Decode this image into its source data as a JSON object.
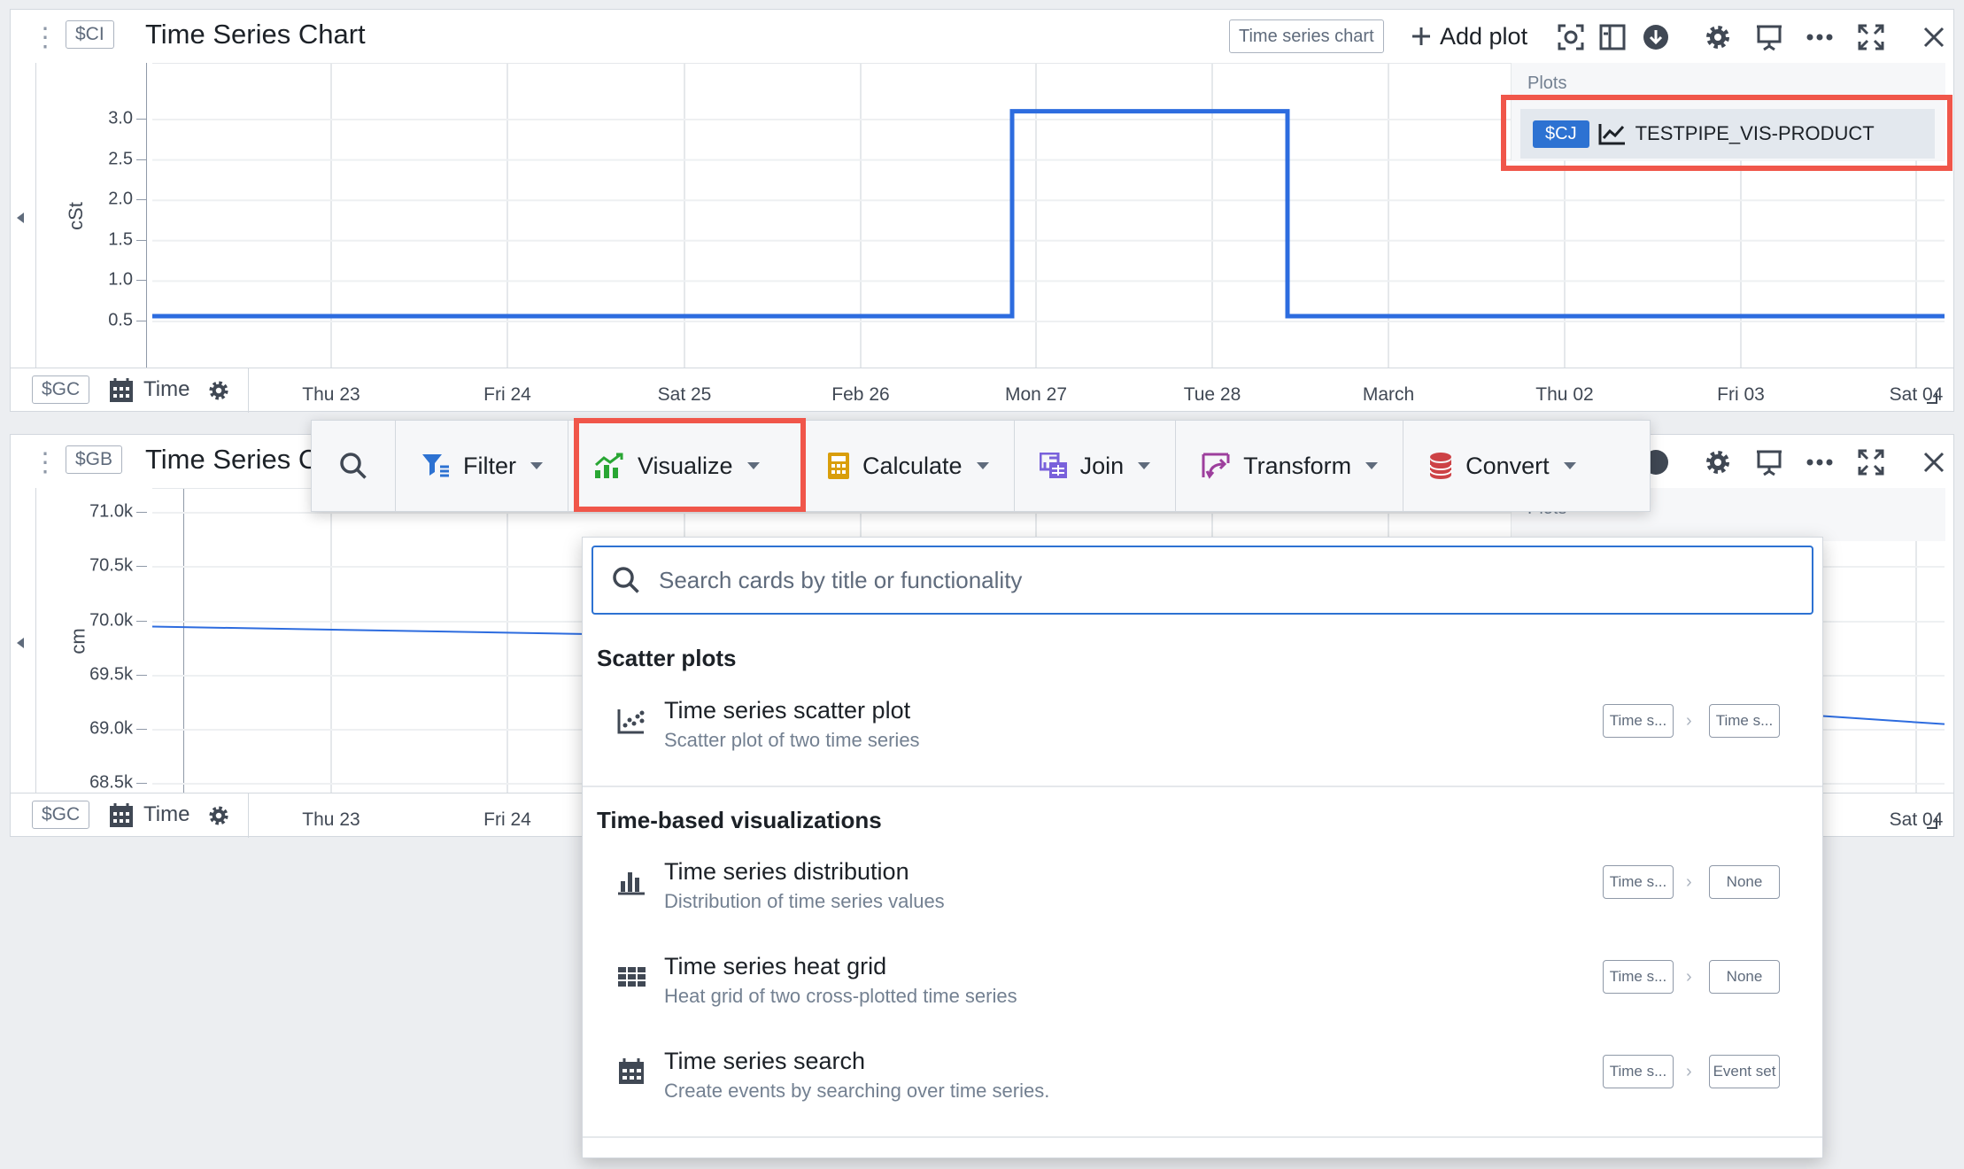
{
  "card1": {
    "grip": "⋮⋮",
    "id_tag": "$CI",
    "title": "Time Series Chart",
    "type_tag": "Time series chart",
    "add_plot": "Add plot",
    "y_label": "cSt",
    "y_ticks": [
      "3.0",
      "2.5",
      "2.0",
      "1.5",
      "1.0",
      "0.5"
    ],
    "x_tag": "$GC",
    "x_label": "Time",
    "plots_label": "Plots",
    "plot_badge": "$CJ",
    "plot_name": "TESTPIPE_VIS-PRODUCT"
  },
  "card2": {
    "grip": "⋮⋮",
    "id_tag": "$GB",
    "title": "Time Series Ch",
    "y_label": "cm",
    "y_ticks": [
      "71.0k",
      "70.5k",
      "70.0k",
      "69.5k",
      "69.0k",
      "68.5k"
    ],
    "x_tag": "$GC",
    "x_label": "Time",
    "plots_label": "Plots"
  },
  "x_ticks": [
    "Thu 23",
    "Fri 24",
    "Sat 25",
    "Feb 26",
    "Mon 27",
    "Tue 28",
    "March",
    "Thu 02",
    "Fri 03",
    "Sat 04"
  ],
  "x_ticks_card2": [
    "Thu 23",
    "Fri 24",
    "Sat 04"
  ],
  "toolbar": {
    "filter": "Filter",
    "visualize": "Visualize",
    "calculate": "Calculate",
    "join": "Join",
    "transform": "Transform",
    "convert": "Convert"
  },
  "dropdown": {
    "search_placeholder": "Search cards by title or functionality",
    "section1": "Scatter plots",
    "section2": "Time-based visualizations",
    "options": [
      {
        "title": "Time series scatter plot",
        "desc": "Scatter plot of two time series",
        "in": "Time s...",
        "out": "Time s..."
      },
      {
        "title": "Time series distribution",
        "desc": "Distribution of time series values",
        "in": "Time s...",
        "out": "None"
      },
      {
        "title": "Time series heat grid",
        "desc": "Heat grid of two cross-plotted time series",
        "in": "Time s...",
        "out": "None"
      },
      {
        "title": "Time series search",
        "desc": "Create events by searching over time series.",
        "in": "Time s...",
        "out": "Event set"
      }
    ]
  },
  "colors": {
    "accent": "#2d72d2",
    "highlight": "#f0564a",
    "series_line": "#2d6cdf",
    "visualize_icon": "#29a634",
    "calculate_icon": "#d99e0b",
    "join_icon": "#7961db",
    "transform_icon": "#9d3f9d",
    "convert_icon": "#cd4246"
  },
  "chart_data": [
    {
      "type": "line",
      "ylabel": "cSt",
      "ylim": [
        0.5,
        3.3
      ],
      "x": [
        "Thu 23",
        "Fri 24",
        "Sat 25",
        "Feb 26",
        "Mon 27",
        "Tue 28",
        "March",
        "Thu 02",
        "Fri 03",
        "Sat 04"
      ],
      "series": [
        {
          "name": "TESTPIPE_VIS-PRODUCT",
          "values": [
            0.5,
            0.5,
            0.5,
            0.5,
            3.3,
            3.3,
            0.5,
            0.5,
            0.5,
            0.5
          ]
        }
      ]
    },
    {
      "type": "line",
      "ylabel": "cm",
      "ylim": [
        68.5,
        71.0
      ],
      "x": [
        "Thu 23",
        "Fri 24",
        "Sat 04"
      ],
      "series": [
        {
          "values": [
            69.95,
            69.88,
            69.05
          ]
        }
      ]
    }
  ]
}
